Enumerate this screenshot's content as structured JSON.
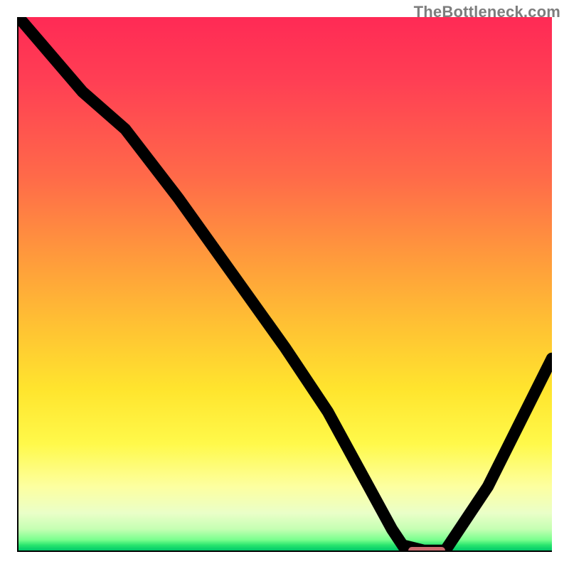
{
  "watermark": {
    "text": "TheBottleneck.com"
  },
  "chart_data": {
    "type": "line",
    "title": "",
    "xlabel": "",
    "ylabel": "",
    "xlim": [
      0,
      100
    ],
    "ylim": [
      0,
      100
    ],
    "grid": false,
    "legend": false,
    "series": [
      {
        "name": "bottleneck-curve",
        "x": [
          0,
          6,
          12,
          20,
          30,
          40,
          50,
          58,
          64,
          70,
          72,
          76,
          80,
          88,
          94,
          100
        ],
        "y": [
          100,
          93,
          86,
          79,
          66,
          52,
          38,
          26,
          15,
          4,
          1,
          0,
          0,
          12,
          24,
          36
        ]
      }
    ],
    "marker": {
      "name": "optimal-range",
      "x_start": 73,
      "x_end": 80,
      "y": 0,
      "color": "#cc6a6f"
    },
    "gradient_stops": [
      {
        "pos": 0,
        "color": "#ff2a55"
      },
      {
        "pos": 12,
        "color": "#ff3f54"
      },
      {
        "pos": 30,
        "color": "#ff6a49"
      },
      {
        "pos": 45,
        "color": "#ff9a3c"
      },
      {
        "pos": 58,
        "color": "#ffc233"
      },
      {
        "pos": 70,
        "color": "#ffe52e"
      },
      {
        "pos": 80,
        "color": "#fff94a"
      },
      {
        "pos": 88,
        "color": "#fdffa0"
      },
      {
        "pos": 93,
        "color": "#eaffc8"
      },
      {
        "pos": 96,
        "color": "#c5ffb3"
      },
      {
        "pos": 98,
        "color": "#7aff8e"
      },
      {
        "pos": 99,
        "color": "#29e56e"
      },
      {
        "pos": 100,
        "color": "#00c86a"
      }
    ]
  }
}
